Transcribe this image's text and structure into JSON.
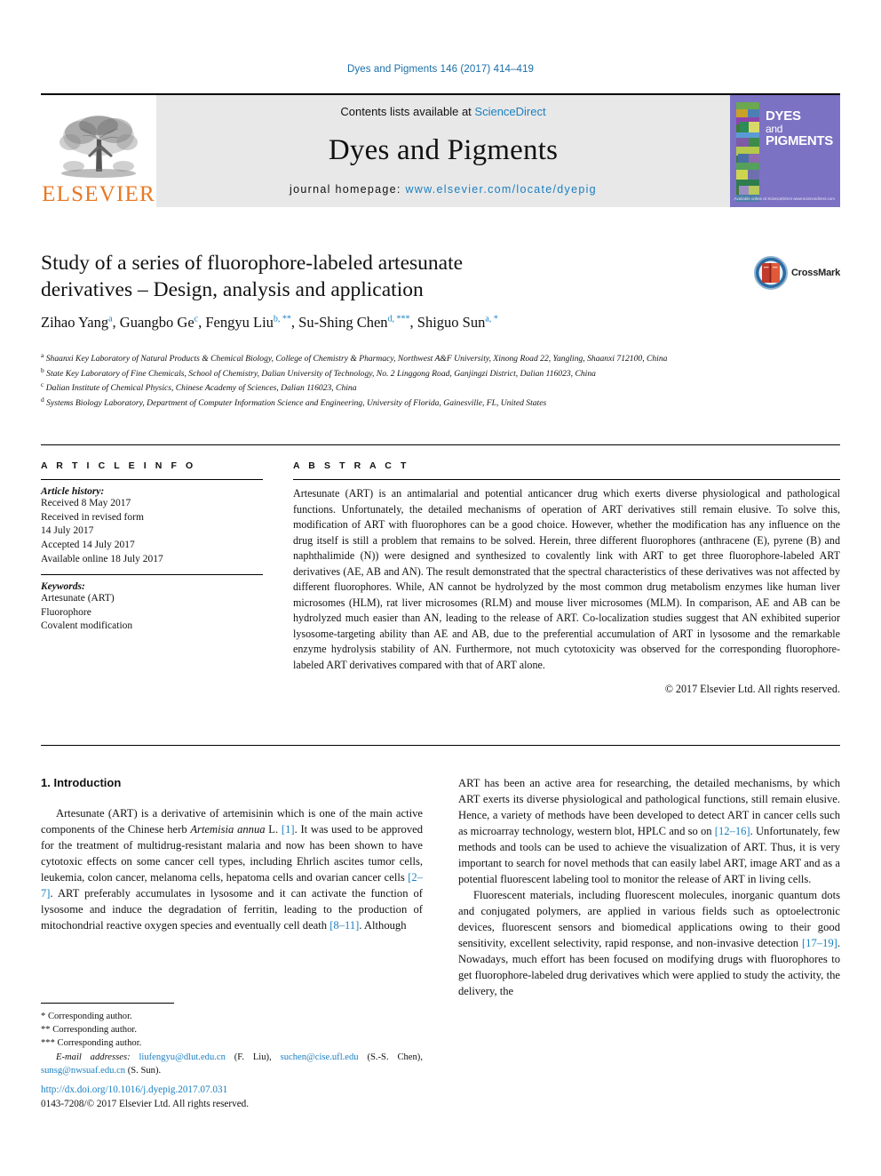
{
  "running_head": "Dyes and Pigments 146 (2017) 414–419",
  "masthead": {
    "publisher_logo_text": "ELSEVIER",
    "contents_prefix": "Contents lists available at ",
    "contents_link": "ScienceDirect",
    "journal_title": "Dyes and Pigments",
    "homepage_prefix": "journal homepage: ",
    "homepage_url": "www.elsevier.com/locate/dyepig",
    "cover": {
      "line1": "DYES",
      "line2": "and",
      "line3": "PIGMENTS",
      "footer": "Available online at\nScienceDirect\nwww.sciencedirect.com",
      "background_color": "#7b72c4"
    }
  },
  "article": {
    "title_line1": "Study of a series of fluorophore-labeled artesunate",
    "title_line2": "derivatives – Design, analysis and application",
    "crossmark_label": "CrossMark",
    "authors": [
      {
        "name": "Zihao Yang",
        "marks": "a",
        "trailing": ","
      },
      {
        "name": "Guangbo Ge",
        "marks": "c",
        "trailing": ","
      },
      {
        "name": "Fengyu Liu",
        "marks": "b, **",
        "trailing": ","
      },
      {
        "name": "Su-Shing Chen",
        "marks": "d, ***",
        "trailing": ","
      },
      {
        "name": "Shiguo Sun",
        "marks": "a, *",
        "trailing": ""
      }
    ],
    "affiliations": [
      {
        "mark": "a",
        "text": "Shaanxi Key Laboratory of Natural Products & Chemical Biology, College of Chemistry & Pharmacy, Northwest A&F University, Xinong Road 22, Yangling, Shaanxi 712100, China"
      },
      {
        "mark": "b",
        "text": "State Key Laboratory of Fine Chemicals, School of Chemistry, Dalian University of Technology, No. 2 Linggong Road, Ganjingzi District, Dalian 116023, China"
      },
      {
        "mark": "c",
        "text": "Dalian Institute of Chemical Physics, Chinese Academy of Sciences, Dalian 116023, China"
      },
      {
        "mark": "d",
        "text": "Systems Biology Laboratory, Department of Computer Information Science and Engineering, University of Florida, Gainesville, FL, United States"
      }
    ]
  },
  "article_info": {
    "heading": "A R T I C L E   I N F O",
    "history_label": "Article history:",
    "history_lines": [
      "Received 8 May 2017",
      "Received in revised form",
      "14 July 2017",
      "Accepted 14 July 2017",
      "Available online 18 July 2017"
    ],
    "keywords_label": "Keywords:",
    "keywords": [
      "Artesunate (ART)",
      "Fluorophore",
      "Covalent modification"
    ]
  },
  "abstract": {
    "heading": "A B S T R A C T",
    "text": "Artesunate (ART) is an antimalarial and potential anticancer drug which exerts diverse physiological and pathological functions. Unfortunately, the detailed mechanisms of operation of ART derivatives still remain elusive. To solve this, modification of ART with fluorophores can be a good choice. However, whether the modification has any influence on the drug itself is still a problem that remains to be solved. Herein, three different fluorophores (anthracene (E), pyrene (B) and naphthalimide (N)) were designed and synthesized to covalently link with ART to get three fluorophore-labeled ART derivatives (AE, AB and AN). The result demonstrated that the spectral characteristics of these derivatives was not affected by different fluorophores. While, AN cannot be hydrolyzed by the most common drug metabolism enzymes like human liver microsomes (HLM), rat liver microsomes (RLM) and mouse liver microsomes (MLM). In comparison, AE and AB can be hydrolyzed much easier than AN, leading to the release of ART. Co-localization studies suggest that AN exhibited superior lysosome-targeting ability than AE and AB, due to the preferential accumulation of ART in lysosome and the remarkable enzyme hydrolysis stability of AN. Furthermore, not much cytotoxicity was observed for the corresponding fluorophore-labeled ART derivatives compared with that of ART alone.",
    "copyright": "© 2017 Elsevier Ltd. All rights reserved."
  },
  "body": {
    "section_number_title": "1. Introduction",
    "left_paragraphs": [
      "Artesunate (ART) is a derivative of artemisinin which is one of the main active components of the Chinese herb Artemisia annua L. [1]. It was used to be approved for the treatment of multidrug-resistant malaria and now has been shown to have cytotoxic effects on some cancer cell types, including Ehrlich ascites tumor cells, leukemia, colon cancer, melanoma cells, hepatoma cells and ovarian cancer cells [2–7]. ART preferably accumulates in lysosome and it can activate the function of lysosome and induce the degradation of ferritin, leading to the production of mitochondrial reactive oxygen species and eventually cell death [8–11]. Although"
    ],
    "right_paragraphs": [
      "ART has been an active area for researching, the detailed mechanisms, by which ART exerts its diverse physiological and pathological functions, still remain elusive. Hence, a variety of methods have been developed to detect ART in cancer cells such as microarray technology, western blot, HPLC and so on [12–16]. Unfortunately, few methods and tools can be used to achieve the visualization of ART. Thus, it is very important to search for novel methods that can easily label ART, image ART and as a potential fluorescent labeling tool to monitor the release of ART in living cells.",
      "Fluorescent materials, including fluorescent molecules, inorganic quantum dots and conjugated polymers, are applied in various fields such as optoelectronic devices, fluorescent sensors and biomedical applications owing to their good sensitivity, excellent selectivity, rapid response, and non-invasive detection [17–19]. Nowadays, much effort has been focused on modifying drugs with fluorophores to get fluorophore-labeled drug derivatives which were applied to study the activity, the delivery, the"
    ]
  },
  "footnotes": {
    "corresponding_1": "* Corresponding author.",
    "corresponding_2": "** Corresponding author.",
    "corresponding_3": "*** Corresponding author.",
    "email_label": "E-mail addresses:",
    "emails": [
      {
        "address": "liufengyu@dlut.edu.cn",
        "person": "(F. Liu)"
      },
      {
        "address": "suchen@cise.ufl.edu",
        "person": "(S.-S. Chen)"
      },
      {
        "address": "sunsg@nwsuaf.edu.cn",
        "person": "(S. Sun)"
      }
    ],
    "doi": "http://dx.doi.org/10.1016/j.dyepig.2017.07.031",
    "issn_line": "0143-7208/© 2017 Elsevier Ltd. All rights reserved."
  },
  "colors": {
    "link_blue": "#1a7fc1",
    "elsevier_orange": "#E87722",
    "cover_purple": "#7b72c4"
  }
}
